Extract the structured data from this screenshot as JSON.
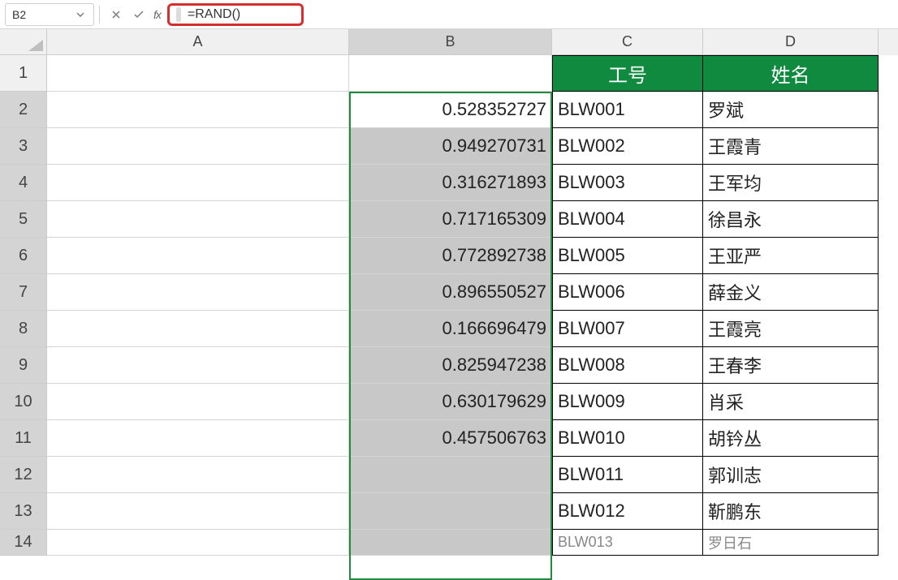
{
  "formula_bar": {
    "cell_ref": "B2",
    "formula": "=RAND()"
  },
  "columns": [
    "A",
    "B",
    "C",
    "D"
  ],
  "headers": {
    "C": "工号",
    "D": "姓名"
  },
  "rows": [
    {
      "n": 1,
      "B": "",
      "C": "",
      "D": ""
    },
    {
      "n": 2,
      "B": "0.528352727",
      "C": "BLW001",
      "D": "罗斌"
    },
    {
      "n": 3,
      "B": "0.949270731",
      "C": "BLW002",
      "D": "王霞青"
    },
    {
      "n": 4,
      "B": "0.316271893",
      "C": "BLW003",
      "D": "王军均"
    },
    {
      "n": 5,
      "B": "0.717165309",
      "C": "BLW004",
      "D": "徐昌永"
    },
    {
      "n": 6,
      "B": "0.772892738",
      "C": "BLW005",
      "D": "王亚严"
    },
    {
      "n": 7,
      "B": "0.896550527",
      "C": "BLW006",
      "D": "薛金义"
    },
    {
      "n": 8,
      "B": "0.166696479",
      "C": "BLW007",
      "D": "王霞亮"
    },
    {
      "n": 9,
      "B": "0.825947238",
      "C": "BLW008",
      "D": "王春李"
    },
    {
      "n": 10,
      "B": "0.630179629",
      "C": "BLW009",
      "D": "肖采"
    },
    {
      "n": 11,
      "B": "0.457506763",
      "C": "BLW010",
      "D": "胡钤丛"
    },
    {
      "n": 12,
      "B": "",
      "C": "BLW011",
      "D": "郭训志"
    },
    {
      "n": 13,
      "B": "",
      "C": "BLW012",
      "D": "靳鹏东"
    }
  ],
  "row14_partial": {
    "n": 14,
    "C_partial": "BLW013",
    "D_partial": "罗日石"
  }
}
